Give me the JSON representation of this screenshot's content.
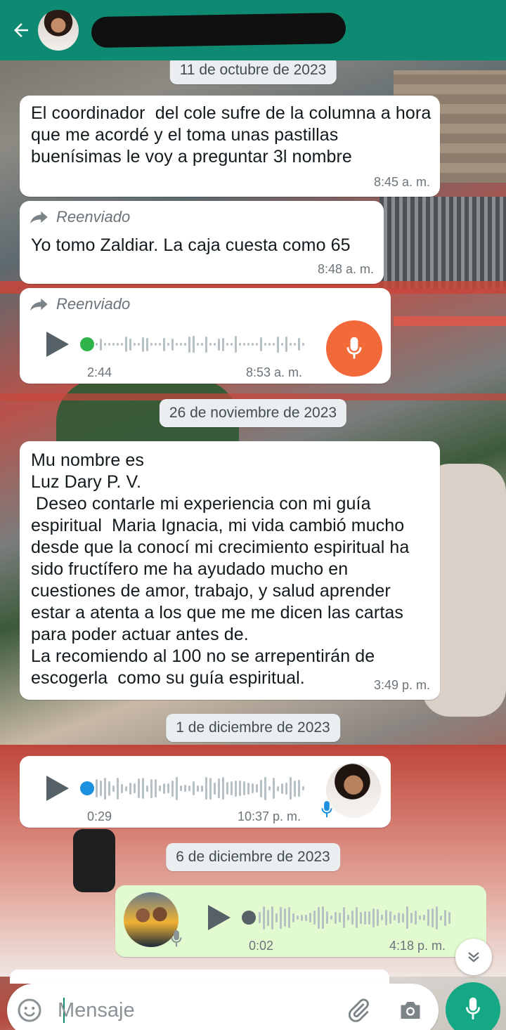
{
  "colors": {
    "header": "#0f8a72",
    "incoming": "#ffffff",
    "outgoing": "#e2fad0",
    "accent_mic": "#14a884",
    "recording_mic": "#f26a3a",
    "played_dot": "#2fb34a",
    "unplayed_dot": "#1e90e0"
  },
  "header": {
    "icons": [
      "back-arrow-icon",
      "video-call-icon",
      "phone-icon",
      "more-vert-icon"
    ]
  },
  "dates": {
    "d1": "11 de octubre de 2023",
    "d2": "26 de noviembre de 2023",
    "d3": "1 de diciembre de 2023",
    "d4": "6 de diciembre de 2023"
  },
  "messages": {
    "m1": {
      "text": "El coordinador  del cole sufre de la columna a hora que me acordé y el toma unas pastillas buenísimas le voy a preguntar 3l nombre",
      "time": "8:45 a. m."
    },
    "m2": {
      "forwarded": "Reenviado",
      "text": "Yo tomo Zaldiar. La caja cuesta como 65",
      "time": "8:48 a. m."
    },
    "m3": {
      "forwarded": "Reenviado",
      "duration": "2:44",
      "time": "8:53 a. m."
    },
    "m4": {
      "text": "Mu nombre es\nLuz Dary P. V.\n Deseo contarle mi experiencia con mi guía espiritual  Maria Ignacia, mi vida cambió mucho desde que la conocí mi crecimiento espiritual ha sido fructífero me ha ayudado mucho en cuestiones de amor, trabajo, y salud aprender estar a atenta a los que me me dicen las cartas para poder actuar antes de.\nLa recomiendo al 100 no se arrepentirán de escogerla  como su guía espiritual.",
      "time": "3:49 p. m."
    },
    "m5": {
      "duration": "0:29",
      "time": "10:37 p. m."
    },
    "m6": {
      "duration": "0:02",
      "time": "4:18 p. m."
    }
  },
  "composer": {
    "placeholder": "Mensaje"
  }
}
